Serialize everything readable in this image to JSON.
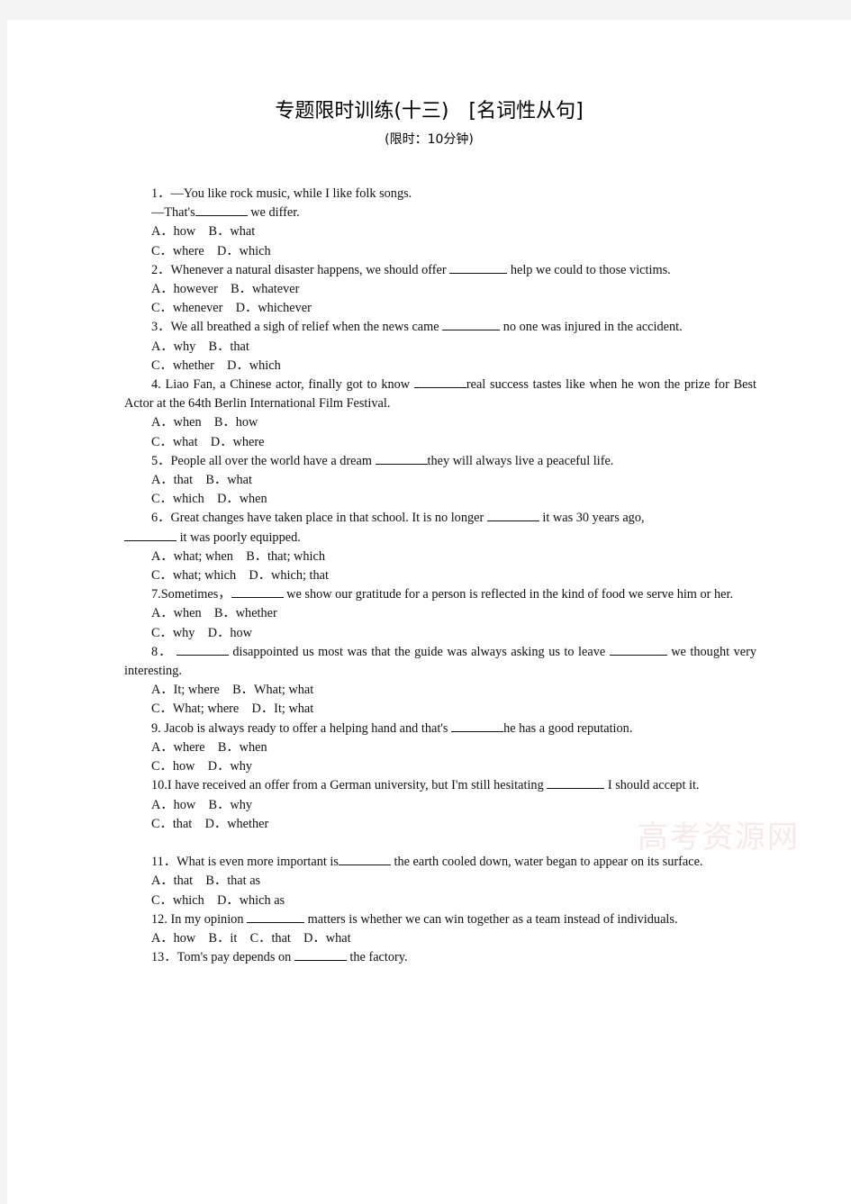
{
  "page": {
    "title": "专题限时训练(十三)　[名词性从句]",
    "subtitle": "(限时：10分钟)",
    "watermark": "高考资源网"
  },
  "questions": [
    {
      "number": "1．",
      "stem": "—You like rock music, while I like folk songs.",
      "stem2": "—That's",
      "stem2_after": "we differ.",
      "options_line1": "A．how　B．what",
      "options_line2": "C．where　D．which"
    },
    {
      "number": "2．",
      "stem_before": "Whenever a natural disaster happens, we should offer",
      "stem_after": "help we could to those victims.",
      "options_line1": "A．however　B．whatever",
      "options_line2": "C．whenever　D．whichever"
    },
    {
      "number": "3．",
      "stem_before": "We all breathed a sigh of relief when the news came",
      "stem_after": "no one was injured in the accident.",
      "options_line1": "A．why　B．that",
      "options_line2": "C．whether　D．which"
    },
    {
      "number": "4.",
      "stem_before": "Liao Fan, a Chinese actor, finally got to know",
      "stem_after": "real success tastes like when he won the prize for Best Actor at the 64th Berlin International Film Festival.",
      "options_line1": "A．when　B．how",
      "options_line2": "C．what　D．where"
    },
    {
      "number": "5．",
      "stem_before": "People all over the world have a dream",
      "stem_after": "they will always live a peaceful life.",
      "options_line1": "A．that　B．what",
      "options_line2": "C．which　D．when"
    },
    {
      "number": "6．",
      "stem_before": "Great changes have taken place in that school. It is no longer",
      "stem_mid": "it was 30 years ago,",
      "stem_after": "it was poorly equipped.",
      "options_line1": "A．what; when　B．that; which",
      "options_line2": "C．what; which　D．which; that"
    },
    {
      "number": "7.",
      "stem_before": "Sometimes，",
      "stem_after": "we show our gratitude for a person is reflected in the kind of food we serve him or her.",
      "options_line1": "A．when　B．whether",
      "options_line2": "C．why　D．how"
    },
    {
      "number": "8．",
      "stem_before": "",
      "stem_mid": "disappointed us most was that the guide was always asking us to leave",
      "stem_after": "we thought very interesting.",
      "options_line1": "A．It; where　B．What; what",
      "options_line2": "C．What; where　D．It; what"
    },
    {
      "number": "9.",
      "stem_before": "Jacob is always ready to offer a helping hand and that's",
      "stem_after": "he has a good reputation.",
      "options_line1": "A．where　B．when",
      "options_line2": "C．how　D．why"
    },
    {
      "number": "10.",
      "stem_before": "I have received an offer from a German university, but I'm still hesitating",
      "stem_after": "I should accept it.",
      "options_line1": "A．how　B．why",
      "options_line2": "C．that　D．whether"
    },
    {
      "number": "11．",
      "stem_before": "What is even more important is",
      "stem_after": "the earth cooled down, water began to appear on its surface.",
      "options_line1": "A．that　B．that as",
      "options_line2": "C．which　D．which as"
    },
    {
      "number": "12.",
      "stem_before": "In my opinion",
      "stem_after": "matters is whether we can win together as a team instead of individuals.",
      "options_line1": "A．how　B．it　C．that　D．what",
      "options_line2": ""
    },
    {
      "number": "13．",
      "stem_before": "Tom's pay depends on",
      "stem_after": "the factory.",
      "options_line1": "",
      "options_line2": ""
    }
  ]
}
